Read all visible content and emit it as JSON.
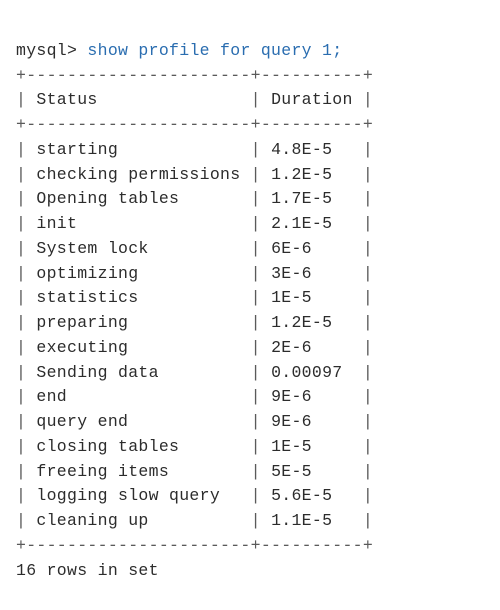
{
  "prompt": "mysql>",
  "command": "show profile for query 1;",
  "columns": [
    "Status",
    "Duration"
  ],
  "rows": [
    {
      "status": "starting",
      "duration": "4.8E-5"
    },
    {
      "status": "checking permissions",
      "duration": "1.2E-5"
    },
    {
      "status": "Opening tables",
      "duration": "1.7E-5"
    },
    {
      "status": "init",
      "duration": "2.1E-5"
    },
    {
      "status": "System lock",
      "duration": "6E-6"
    },
    {
      "status": "optimizing",
      "duration": "3E-6"
    },
    {
      "status": "statistics",
      "duration": "1E-5"
    },
    {
      "status": "preparing",
      "duration": "1.2E-5"
    },
    {
      "status": "executing",
      "duration": "2E-6"
    },
    {
      "status": "Sending data",
      "duration": "0.00097"
    },
    {
      "status": "end",
      "duration": "9E-6"
    },
    {
      "status": "query end",
      "duration": "9E-6"
    },
    {
      "status": "closing tables",
      "duration": "1E-5"
    },
    {
      "status": "freeing items",
      "duration": "5E-5"
    },
    {
      "status": "logging slow query",
      "duration": "5.6E-5"
    },
    {
      "status": "cleaning up",
      "duration": "1.1E-5"
    }
  ],
  "footer": "16 rows in set",
  "table_format": {
    "col1_width": 22,
    "col2_width": 10,
    "border_line": "+----------------------+----------+"
  },
  "chart_data": {
    "type": "table",
    "title": "show profile for query 1",
    "columns": [
      "Status",
      "Duration"
    ],
    "series": [
      {
        "name": "Status",
        "values": [
          "starting",
          "checking permissions",
          "Opening tables",
          "init",
          "System lock",
          "optimizing",
          "statistics",
          "preparing",
          "executing",
          "Sending data",
          "end",
          "query end",
          "closing tables",
          "freeing items",
          "logging slow query",
          "cleaning up"
        ]
      },
      {
        "name": "Duration",
        "values": [
          4.8e-05,
          1.2e-05,
          1.7e-05,
          2.1e-05,
          6e-06,
          3e-06,
          1e-05,
          1.2e-05,
          2e-06,
          0.00097,
          9e-06,
          9e-06,
          1e-05,
          5e-05,
          5.6e-05,
          1.1e-05
        ]
      }
    ]
  }
}
